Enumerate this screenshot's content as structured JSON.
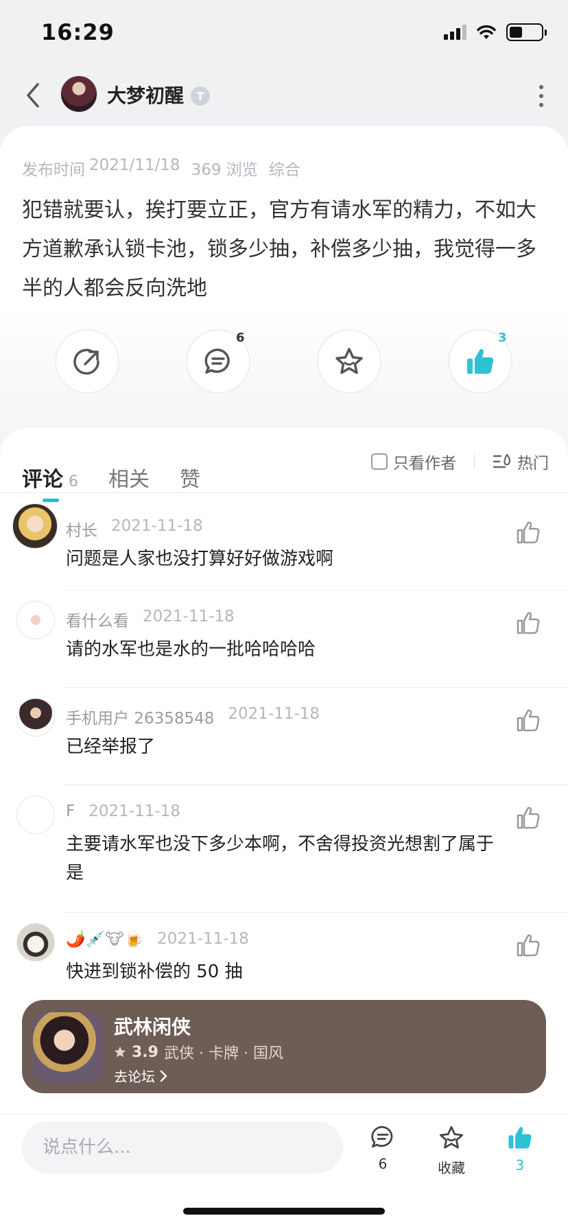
{
  "status_bar": {
    "time": "16:29"
  },
  "header": {
    "author_name": "大梦初醒",
    "level_badge": "T"
  },
  "post": {
    "publish_label": "发布时间",
    "publish_date": "2021/11/18",
    "views": "369 浏览",
    "category": "综合",
    "body": "犯错就要认，挨打要立正，官方有请水军的精力，不如大方道歉承认锁卡池，锁多少抽，补偿多少抽，我觉得一多半的人都会反向洗地",
    "comment_count": "6",
    "like_count": "3"
  },
  "tabs": {
    "comments_label": "评论",
    "comments_count": "6",
    "related_label": "相关",
    "likes_label": "赞",
    "author_only_label": "只看作者",
    "hot_label": "热门"
  },
  "comments": [
    {
      "user": "村长",
      "date": "2021-11-18",
      "text": "问题是人家也没打算好好做游戏啊"
    },
    {
      "user": "看什么看",
      "date": "2021-11-18",
      "text": "请的水军也是水的一批哈哈哈哈"
    },
    {
      "user": "手机用户 26358548",
      "date": "2021-11-18",
      "text": "已经举报了"
    },
    {
      "user": "F",
      "date": "2021-11-18",
      "text": "主要请水军也没下多少本啊，不舍得投资光想割了属于是"
    },
    {
      "user": "🌶️💉🐮🍺",
      "date": "2021-11-18",
      "text": "快进到锁补偿的 50 抽"
    }
  ],
  "game": {
    "name": "武林闲侠",
    "rating": "3.9",
    "tags": "武侠 · 卡牌 · 国风",
    "link_label": "去论坛"
  },
  "bottom_bar": {
    "input_placeholder": "说点什么...",
    "comment_count": "6",
    "favorite_label": "收藏",
    "like_count": "3"
  },
  "colors": {
    "accent": "#17c1d6",
    "banner": "#6e5d55"
  }
}
